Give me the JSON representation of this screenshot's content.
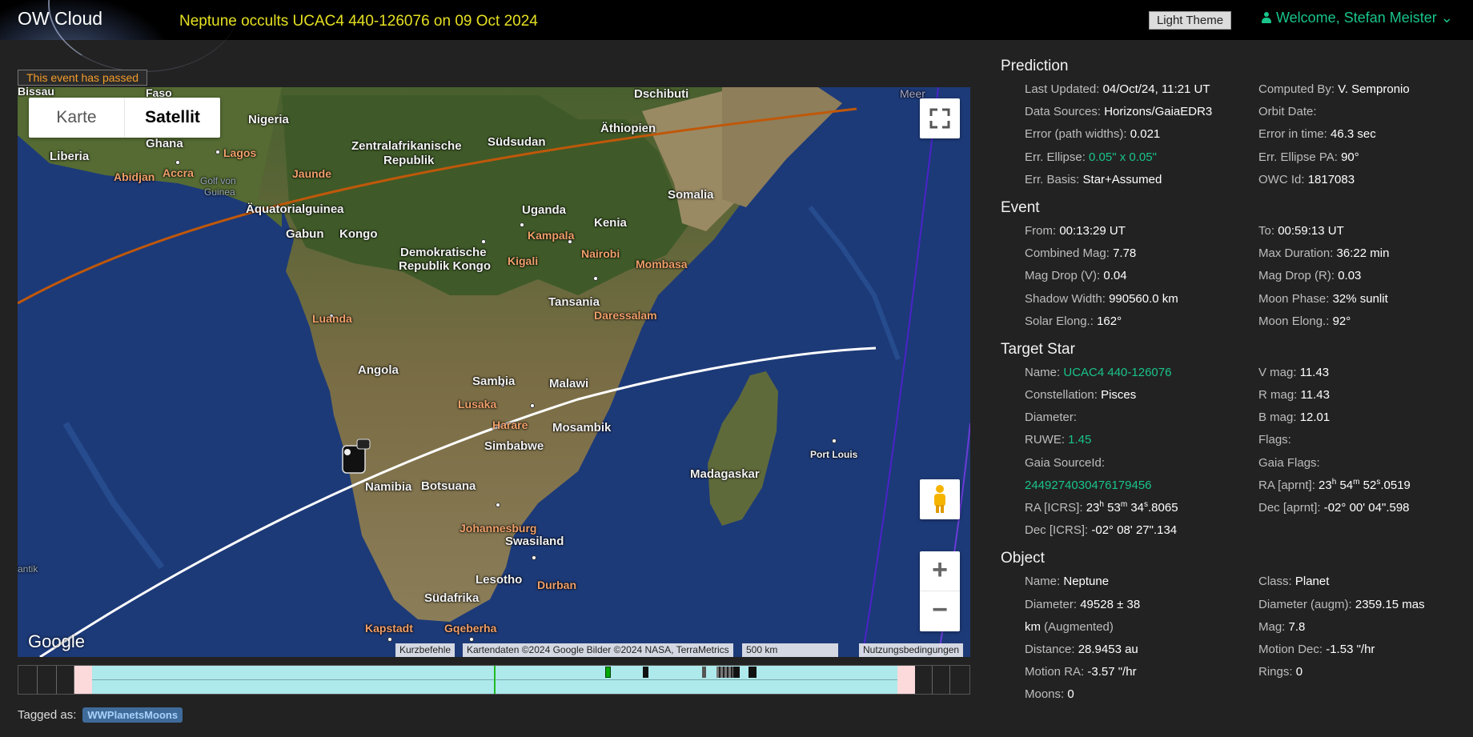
{
  "header": {
    "brand": "OW Cloud",
    "title": "Neptune occults UCAC4 440-126076 on 09 Oct 2024",
    "theme_button": "Light Theme",
    "welcome": "Welcome, Stefan Meister ⌄"
  },
  "map": {
    "passed_badge": "This event has passed",
    "type_map": "Karte",
    "type_satellite": "Satellit",
    "logo": "Google",
    "attribution": {
      "shortcuts": "Kurzbefehle",
      "data": "Kartendaten ©2024 Google Bilder ©2024 NASA, TerraMetrics",
      "scale": "500 km",
      "terms": "Nutzungsbedingungen"
    },
    "labels": {
      "bissau": "Bissau",
      "faso": "Faso",
      "nigeria": "Nigeria",
      "dschibuti": "Dschibuti",
      "meer": "Meer",
      "zar": "Zentralafrikanische",
      "zar2": "Republik",
      "suedsudan": "Südsudan",
      "aethiopien": "Äthiopien",
      "liberia": "Liberia",
      "ghana": "Ghana",
      "lagos": "Lagos",
      "abidjan": "Abidjan",
      "accra": "Accra",
      "jaunde": "Jaunde",
      "golf": "Golf von",
      "golf2": "Guinea",
      "aequatorial": "Äquatorialguinea",
      "uganda": "Uganda",
      "somalia": "Somalia",
      "kenia": "Kenia",
      "kampala": "Kampala",
      "gabun": "Gabun",
      "kongo": "Kongo",
      "drk": "Demokratische",
      "drk2": "Republik Kongo",
      "kigali": "Kigali",
      "nairobi": "Nairobi",
      "mombasa": "Mombasa",
      "tansania": "Tansania",
      "daressalam": "Daressalam",
      "luanda": "Luanda",
      "angola": "Angola",
      "sambia": "Sambia",
      "malawi": "Malawi",
      "lusaka": "Lusaka",
      "harare": "Harare",
      "mosambik": "Mosambik",
      "simbabwe": "Simbabwe",
      "namibia": "Namibia",
      "botsuana": "Botsuana",
      "madagaskar": "Madagaskar",
      "portlouis": "Port Louis",
      "johannesburg": "Johannesburg",
      "swasiland": "Swasiland",
      "lesotho": "Lesotho",
      "durban": "Durban",
      "suedafrika": "Südafrika",
      "kapstadt": "Kapstadt",
      "gqeberha": "Gqeberha",
      "antik": "antik"
    }
  },
  "tags": {
    "label": "Tagged as:",
    "tag": "WWPlanetsMoons"
  },
  "prediction": {
    "title": "Prediction",
    "rows": [
      {
        "k": "Last Updated:",
        "v": "04/Oct/24, 11:21 UT"
      },
      {
        "k": "Computed By:",
        "v": "V. Sempronio"
      },
      {
        "k": "Data Sources:",
        "v": "Horizons/GaiaEDR3"
      },
      {
        "k": "Orbit Date:",
        "v": ""
      },
      {
        "k": "Error (path widths):",
        "v": "0.021"
      },
      {
        "k": "Error in time:",
        "v": "46.3 sec"
      },
      {
        "k": "Err. Ellipse:",
        "v": "0.05\" x 0.05\""
      },
      {
        "k": "Err. Ellipse PA:",
        "v": "90°"
      },
      {
        "k": "Err. Basis:",
        "v": "Star+Assumed"
      },
      {
        "k": "OWC Id:",
        "v": "1817083"
      }
    ]
  },
  "event": {
    "title": "Event",
    "rows": [
      {
        "k": "From:",
        "v": "00:13:29 UT"
      },
      {
        "k": "To:",
        "v": "00:59:13 UT"
      },
      {
        "k": "Combined Mag:",
        "v": "7.78"
      },
      {
        "k": "Max Duration:",
        "v": "36:22 min"
      },
      {
        "k": "Mag Drop (V):",
        "v": "0.04"
      },
      {
        "k": "Mag Drop (R):",
        "v": "0.03"
      },
      {
        "k": "Shadow Width:",
        "v": "990560.0 km"
      },
      {
        "k": "Moon Phase:",
        "v": "32% sunlit"
      },
      {
        "k": "Solar Elong.:",
        "v": "162°"
      },
      {
        "k": "Moon Elong.:",
        "v": "92°"
      }
    ]
  },
  "target": {
    "title": "Target Star",
    "name_k": "Name:",
    "name_v": "UCAC4 440-126076",
    "vmag_k": "V mag:",
    "vmag_v": "11.43",
    "const_k": "Constellation:",
    "const_v": "Pisces",
    "rmag_k": "R mag:",
    "rmag_v": "11.43",
    "diam_k": "Diameter:",
    "diam_v": "",
    "bmag_k": "B mag:",
    "bmag_v": "12.01",
    "ruwe_k": "RUWE:",
    "ruwe_v": "1.45",
    "flags_k": "Flags:",
    "flags_v": "",
    "gaia_k": "Gaia SourceId:",
    "gaia_v": "2449274030476179456",
    "gaiaflags_k": "Gaia Flags:",
    "gaiaflags_v": "",
    "ra_aprnt_k": "RA [aprnt]:",
    "ra_aprnt": {
      "h": "23",
      "m": "54",
      "s": "52",
      "f": ".0519"
    },
    "ra_icrs_k": "RA [ICRS]:",
    "ra_icrs": {
      "h": "23",
      "m": "53",
      "s": "34",
      "f": ".8065"
    },
    "dec_aprnt_k": "Dec [aprnt]:",
    "dec_aprnt": {
      "d": "-02°",
      "m": "00",
      "s": "04",
      "f": ".598"
    },
    "dec_icrs_k": "Dec [ICRS]:",
    "dec_icrs": {
      "d": "-02°",
      "m": "08",
      "s": "27",
      "f": ".134"
    }
  },
  "object": {
    "title": "Object",
    "rows": [
      {
        "k": "Name:",
        "v": "Neptune"
      },
      {
        "k": "Class:",
        "v": "Planet"
      },
      {
        "k": "Diameter:",
        "v": "49528 ± 38"
      },
      {
        "k": "Diameter (augm):",
        "v": "2359.15 mas"
      },
      {
        "k": "",
        "v": "km",
        "extra": "(Augmented)"
      },
      {
        "k": "Mag:",
        "v": "7.8"
      },
      {
        "k": "Distance:",
        "v": "28.9453 au"
      },
      {
        "k": "Motion Dec:",
        "v": "-1.53 \"/hr"
      },
      {
        "k": "Motion RA:",
        "v": "-3.57 \"/hr"
      },
      {
        "k": "Rings:",
        "v": "0"
      },
      {
        "k": "Moons:",
        "v": "0"
      },
      {
        "k": "",
        "v": ""
      }
    ]
  },
  "colors": {
    "accent_green": "#19c48a",
    "title_yellow": "#e5e022",
    "passed_orange": "#f39c2a",
    "path_white": "#ffffff",
    "path_orange": "#c0580a",
    "path_purple": "#4a23c8",
    "timeline_cyan": "#aee9ec"
  }
}
